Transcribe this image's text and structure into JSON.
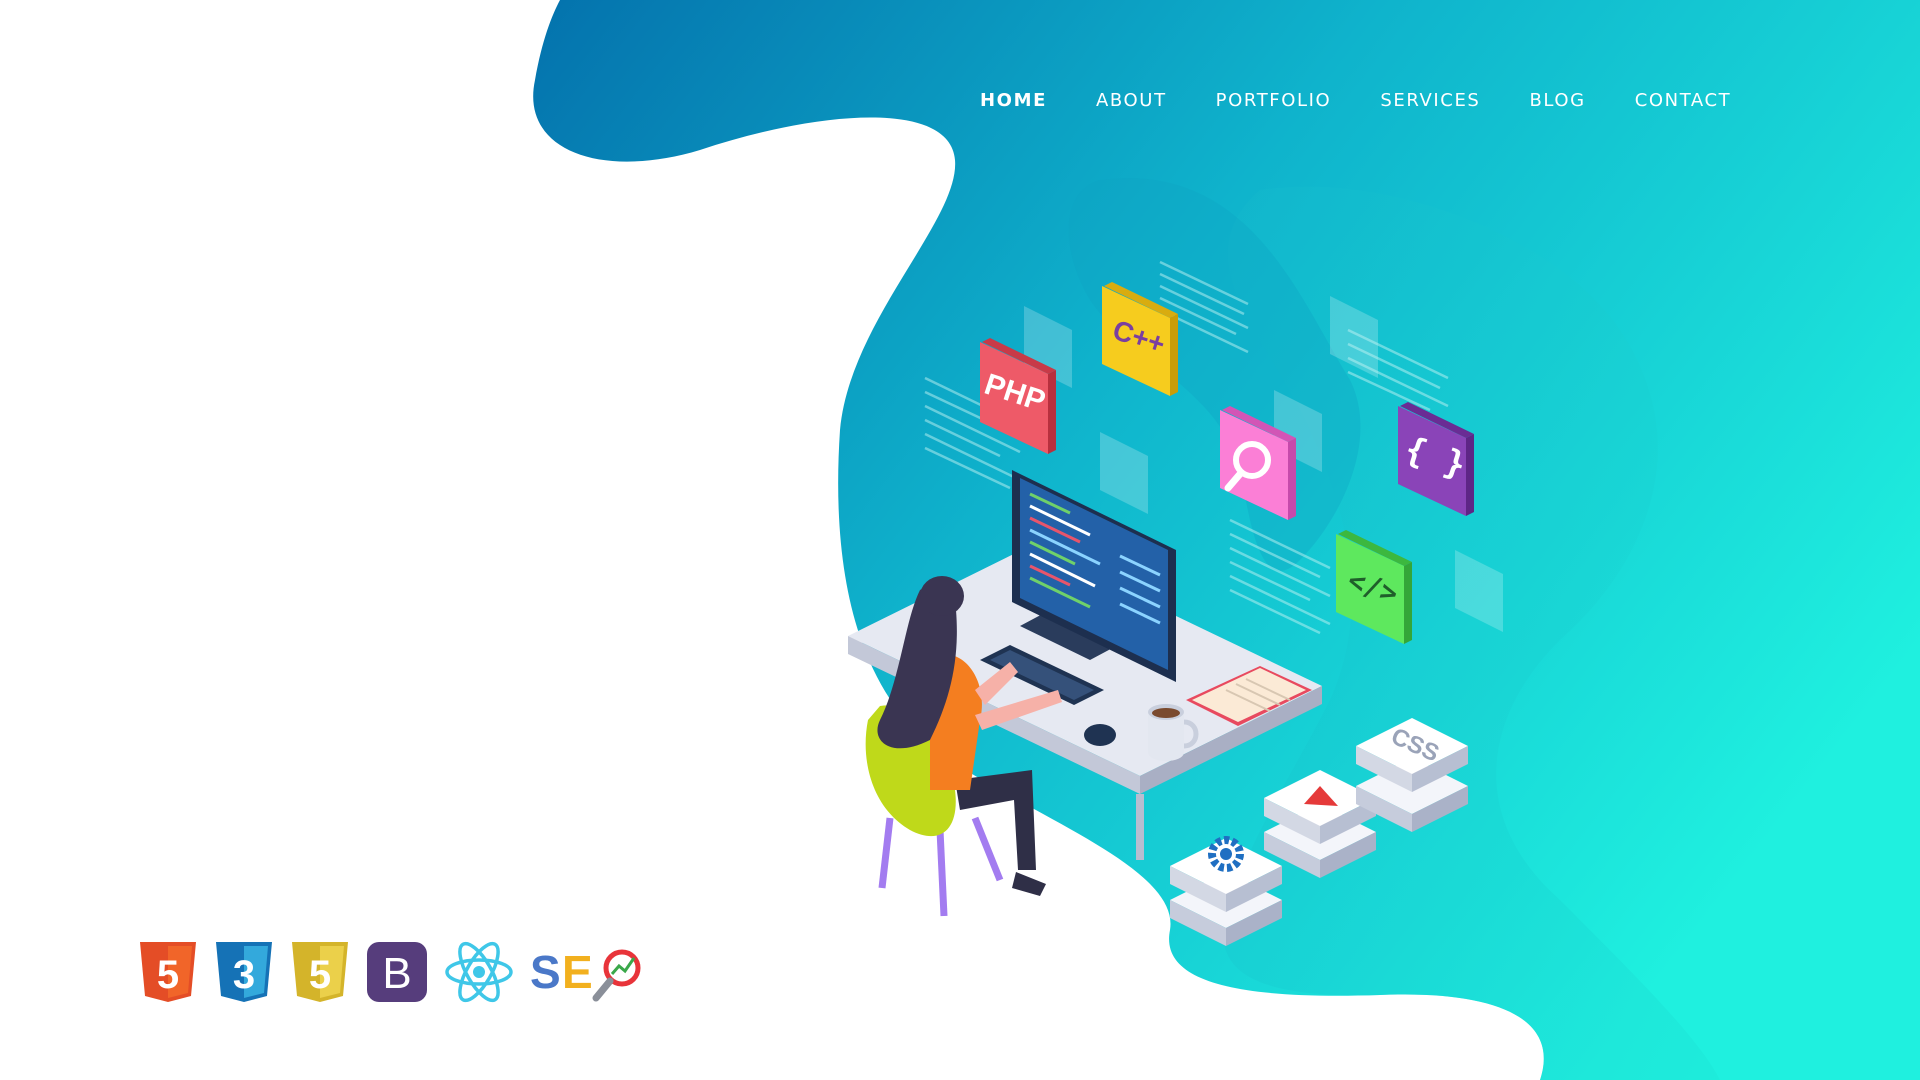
{
  "nav": {
    "items": [
      {
        "label": "HOME",
        "active": true
      },
      {
        "label": "ABOUT",
        "active": false
      },
      {
        "label": "PORTFOLIO",
        "active": false
      },
      {
        "label": "SERVICES",
        "active": false
      },
      {
        "label": "BLOG",
        "active": false
      },
      {
        "label": "CONTACT",
        "active": false
      }
    ]
  },
  "illustration": {
    "floating_icons": {
      "php": "PHP",
      "cpp": "C++",
      "search": "search-icon",
      "braces": "{ }",
      "code": "</>"
    },
    "blocks": {
      "css": "CSS",
      "play": "play-icon",
      "gear": "gear-icon"
    }
  },
  "tech_stack": {
    "items": [
      {
        "name": "html5-icon",
        "label": "5",
        "color": "#e44d26"
      },
      {
        "name": "css3-icon",
        "label": "3",
        "color": "#1572b6"
      },
      {
        "name": "javascript-icon",
        "label": "5",
        "color": "#d4b42a"
      },
      {
        "name": "bootstrap-icon",
        "label": "B",
        "color": "#563d7c"
      },
      {
        "name": "react-icon",
        "label": "",
        "color": "#3fc7e8"
      }
    ],
    "seo": {
      "s": "S",
      "e": "E",
      "s_color": "#4a78c8",
      "e_color": "#f2b01e"
    }
  },
  "colors": {
    "blob_dark": "#0b7fb8",
    "blob_light": "#1de8da",
    "white": "#ffffff"
  }
}
